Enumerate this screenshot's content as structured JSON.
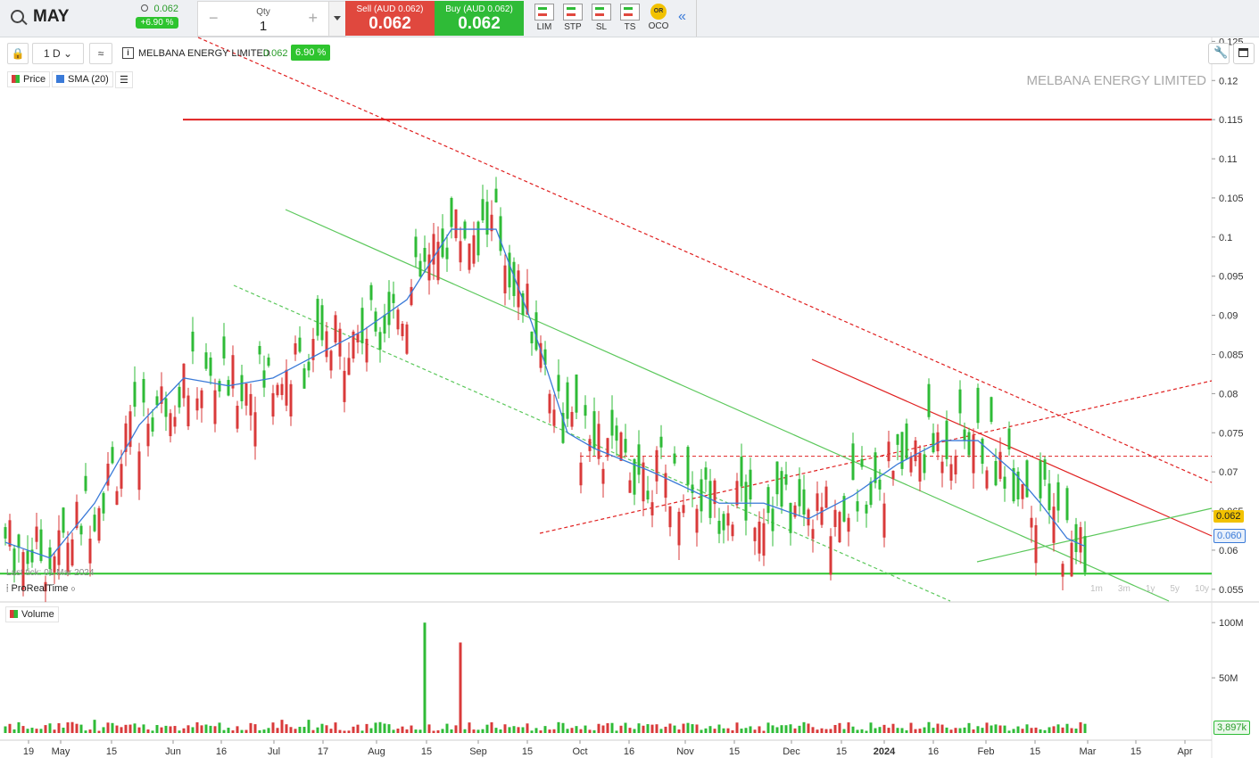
{
  "symbol": {
    "code": "MAY",
    "change_price": "0.062",
    "change_pct": "+6.90 %"
  },
  "qty": {
    "label": "Qty",
    "value": "1",
    "minus": "−",
    "plus": "+"
  },
  "sell": {
    "label": "Sell (AUD 0.062)",
    "value": "0.062"
  },
  "buy": {
    "label": "Buy (AUD 0.062)",
    "value": "0.062"
  },
  "order_types": [
    "LIM",
    "STP",
    "SL",
    "TS",
    "OCO"
  ],
  "oco_badge": "OR",
  "collapse_glyph": "«",
  "toolbar": {
    "interval": "1 D",
    "chevron": "⌄",
    "info": "i"
  },
  "security": {
    "name": "MELBANA ENERGY LIMITED",
    "price": "0.062",
    "pct": "6.90 %"
  },
  "legend": {
    "price": "Price",
    "sma": "SMA (20)",
    "menu_glyph": "☰"
  },
  "watermark": "MELBANA ENERGY LIMITED",
  "last_tick": "Last tick: 01 Mar 2024",
  "provider": "ProRealTime",
  "ranges": [
    "1m",
    "3m",
    "1y",
    "5y",
    "10y"
  ],
  "volume_label": "Volume",
  "colors": {
    "up": "#2fbb37",
    "down": "#d93a3a",
    "sma": "#3a7ad8",
    "support": "#2ec42e",
    "resistance": "#e02020"
  },
  "chart_data": {
    "type": "candlestick",
    "title": "MELBANA ENERGY LIMITED",
    "y_ticks": [
      "0.125",
      "0.12",
      "0.115",
      "0.11",
      "0.105",
      "0.1",
      "0.095",
      "0.09",
      "0.085",
      "0.08",
      "0.075",
      "0.07",
      "0.065",
      "0.06",
      "0.055"
    ],
    "ylim": [
      0.0535,
      0.1255
    ],
    "x_ticks": [
      "19",
      "May",
      "15",
      "Jun",
      "16",
      "Jul",
      "17",
      "Aug",
      "15",
      "Sep",
      "15",
      "Oct",
      "16",
      "Nov",
      "15",
      "Dec",
      "15",
      "2024",
      "16",
      "Feb",
      "15",
      "Mar",
      "15",
      "Apr"
    ],
    "last_price": "0.062",
    "sma_last": "0.060",
    "horizontal_levels": [
      {
        "value": 0.115,
        "style": "resistance"
      },
      {
        "value": 0.057,
        "style": "support"
      },
      {
        "value": 0.072,
        "style": "resistance-dashed"
      }
    ],
    "sma_20": [
      [
        0,
        0.061
      ],
      [
        10,
        0.059
      ],
      [
        20,
        0.066
      ],
      [
        30,
        0.076
      ],
      [
        40,
        0.082
      ],
      [
        50,
        0.081
      ],
      [
        60,
        0.082
      ],
      [
        70,
        0.085
      ],
      [
        80,
        0.088
      ],
      [
        90,
        0.092
      ],
      [
        100,
        0.101
      ],
      [
        110,
        0.101
      ],
      [
        118,
        0.089
      ],
      [
        126,
        0.075
      ],
      [
        132,
        0.073
      ],
      [
        145,
        0.07
      ],
      [
        160,
        0.066
      ],
      [
        170,
        0.066
      ],
      [
        180,
        0.064
      ],
      [
        190,
        0.067
      ],
      [
        200,
        0.071
      ],
      [
        210,
        0.074
      ],
      [
        218,
        0.074
      ],
      [
        226,
        0.07
      ],
      [
        232,
        0.066
      ],
      [
        238,
        0.0615
      ],
      [
        242,
        0.0605
      ]
    ],
    "volume": {
      "y_ticks": [
        "100M",
        "50M"
      ],
      "last": "3,897k",
      "peaks": [
        {
          "label": "Aug 15",
          "value": 100
        },
        {
          "label": "Aug 25",
          "value": 82
        }
      ]
    }
  }
}
